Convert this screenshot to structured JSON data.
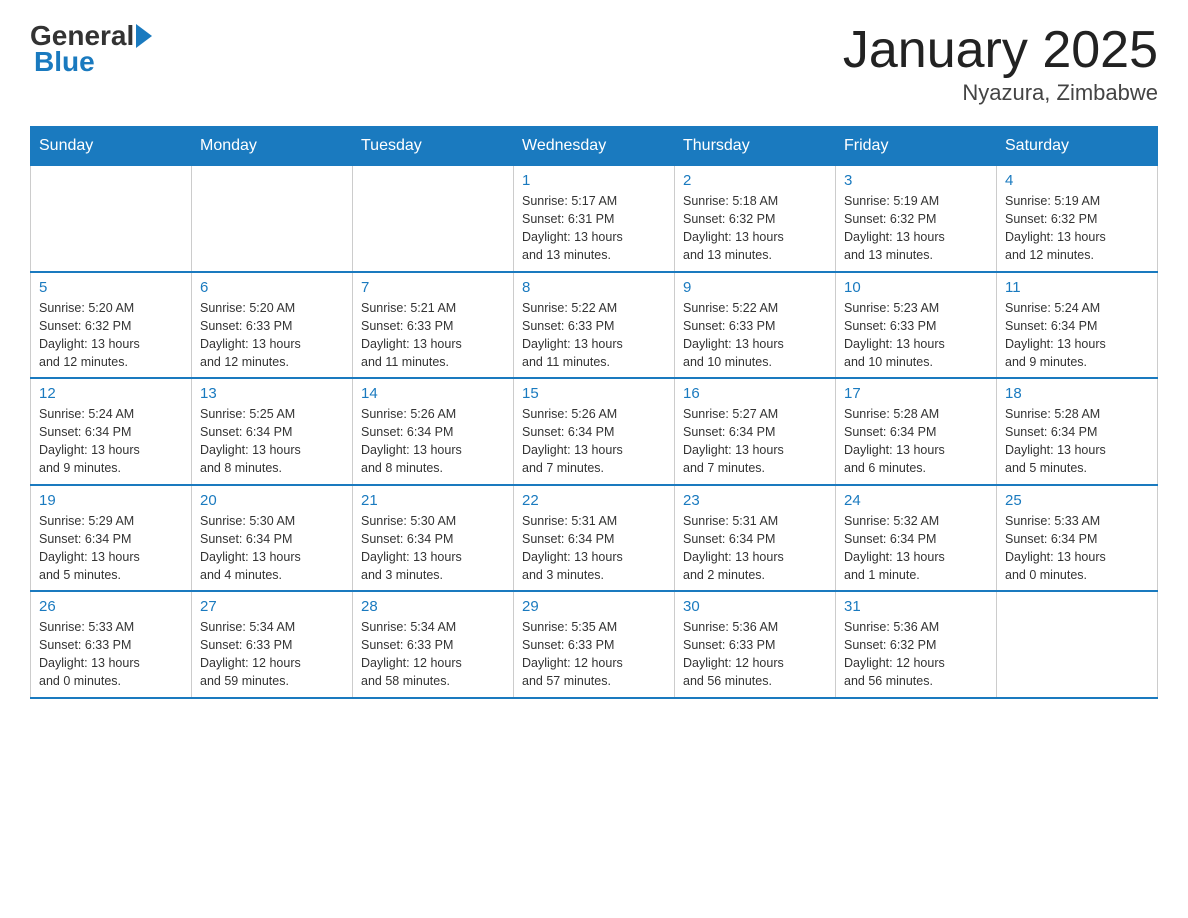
{
  "header": {
    "logo_general": "General",
    "logo_blue": "Blue",
    "title": "January 2025",
    "subtitle": "Nyazura, Zimbabwe"
  },
  "days_of_week": [
    "Sunday",
    "Monday",
    "Tuesday",
    "Wednesday",
    "Thursday",
    "Friday",
    "Saturday"
  ],
  "weeks": [
    [
      {
        "day": "",
        "info": ""
      },
      {
        "day": "",
        "info": ""
      },
      {
        "day": "",
        "info": ""
      },
      {
        "day": "1",
        "info": "Sunrise: 5:17 AM\nSunset: 6:31 PM\nDaylight: 13 hours\nand 13 minutes."
      },
      {
        "day": "2",
        "info": "Sunrise: 5:18 AM\nSunset: 6:32 PM\nDaylight: 13 hours\nand 13 minutes."
      },
      {
        "day": "3",
        "info": "Sunrise: 5:19 AM\nSunset: 6:32 PM\nDaylight: 13 hours\nand 13 minutes."
      },
      {
        "day": "4",
        "info": "Sunrise: 5:19 AM\nSunset: 6:32 PM\nDaylight: 13 hours\nand 12 minutes."
      }
    ],
    [
      {
        "day": "5",
        "info": "Sunrise: 5:20 AM\nSunset: 6:32 PM\nDaylight: 13 hours\nand 12 minutes."
      },
      {
        "day": "6",
        "info": "Sunrise: 5:20 AM\nSunset: 6:33 PM\nDaylight: 13 hours\nand 12 minutes."
      },
      {
        "day": "7",
        "info": "Sunrise: 5:21 AM\nSunset: 6:33 PM\nDaylight: 13 hours\nand 11 minutes."
      },
      {
        "day": "8",
        "info": "Sunrise: 5:22 AM\nSunset: 6:33 PM\nDaylight: 13 hours\nand 11 minutes."
      },
      {
        "day": "9",
        "info": "Sunrise: 5:22 AM\nSunset: 6:33 PM\nDaylight: 13 hours\nand 10 minutes."
      },
      {
        "day": "10",
        "info": "Sunrise: 5:23 AM\nSunset: 6:33 PM\nDaylight: 13 hours\nand 10 minutes."
      },
      {
        "day": "11",
        "info": "Sunrise: 5:24 AM\nSunset: 6:34 PM\nDaylight: 13 hours\nand 9 minutes."
      }
    ],
    [
      {
        "day": "12",
        "info": "Sunrise: 5:24 AM\nSunset: 6:34 PM\nDaylight: 13 hours\nand 9 minutes."
      },
      {
        "day": "13",
        "info": "Sunrise: 5:25 AM\nSunset: 6:34 PM\nDaylight: 13 hours\nand 8 minutes."
      },
      {
        "day": "14",
        "info": "Sunrise: 5:26 AM\nSunset: 6:34 PM\nDaylight: 13 hours\nand 8 minutes."
      },
      {
        "day": "15",
        "info": "Sunrise: 5:26 AM\nSunset: 6:34 PM\nDaylight: 13 hours\nand 7 minutes."
      },
      {
        "day": "16",
        "info": "Sunrise: 5:27 AM\nSunset: 6:34 PM\nDaylight: 13 hours\nand 7 minutes."
      },
      {
        "day": "17",
        "info": "Sunrise: 5:28 AM\nSunset: 6:34 PM\nDaylight: 13 hours\nand 6 minutes."
      },
      {
        "day": "18",
        "info": "Sunrise: 5:28 AM\nSunset: 6:34 PM\nDaylight: 13 hours\nand 5 minutes."
      }
    ],
    [
      {
        "day": "19",
        "info": "Sunrise: 5:29 AM\nSunset: 6:34 PM\nDaylight: 13 hours\nand 5 minutes."
      },
      {
        "day": "20",
        "info": "Sunrise: 5:30 AM\nSunset: 6:34 PM\nDaylight: 13 hours\nand 4 minutes."
      },
      {
        "day": "21",
        "info": "Sunrise: 5:30 AM\nSunset: 6:34 PM\nDaylight: 13 hours\nand 3 minutes."
      },
      {
        "day": "22",
        "info": "Sunrise: 5:31 AM\nSunset: 6:34 PM\nDaylight: 13 hours\nand 3 minutes."
      },
      {
        "day": "23",
        "info": "Sunrise: 5:31 AM\nSunset: 6:34 PM\nDaylight: 13 hours\nand 2 minutes."
      },
      {
        "day": "24",
        "info": "Sunrise: 5:32 AM\nSunset: 6:34 PM\nDaylight: 13 hours\nand 1 minute."
      },
      {
        "day": "25",
        "info": "Sunrise: 5:33 AM\nSunset: 6:34 PM\nDaylight: 13 hours\nand 0 minutes."
      }
    ],
    [
      {
        "day": "26",
        "info": "Sunrise: 5:33 AM\nSunset: 6:33 PM\nDaylight: 13 hours\nand 0 minutes."
      },
      {
        "day": "27",
        "info": "Sunrise: 5:34 AM\nSunset: 6:33 PM\nDaylight: 12 hours\nand 59 minutes."
      },
      {
        "day": "28",
        "info": "Sunrise: 5:34 AM\nSunset: 6:33 PM\nDaylight: 12 hours\nand 58 minutes."
      },
      {
        "day": "29",
        "info": "Sunrise: 5:35 AM\nSunset: 6:33 PM\nDaylight: 12 hours\nand 57 minutes."
      },
      {
        "day": "30",
        "info": "Sunrise: 5:36 AM\nSunset: 6:33 PM\nDaylight: 12 hours\nand 56 minutes."
      },
      {
        "day": "31",
        "info": "Sunrise: 5:36 AM\nSunset: 6:32 PM\nDaylight: 12 hours\nand 56 minutes."
      },
      {
        "day": "",
        "info": ""
      }
    ]
  ]
}
